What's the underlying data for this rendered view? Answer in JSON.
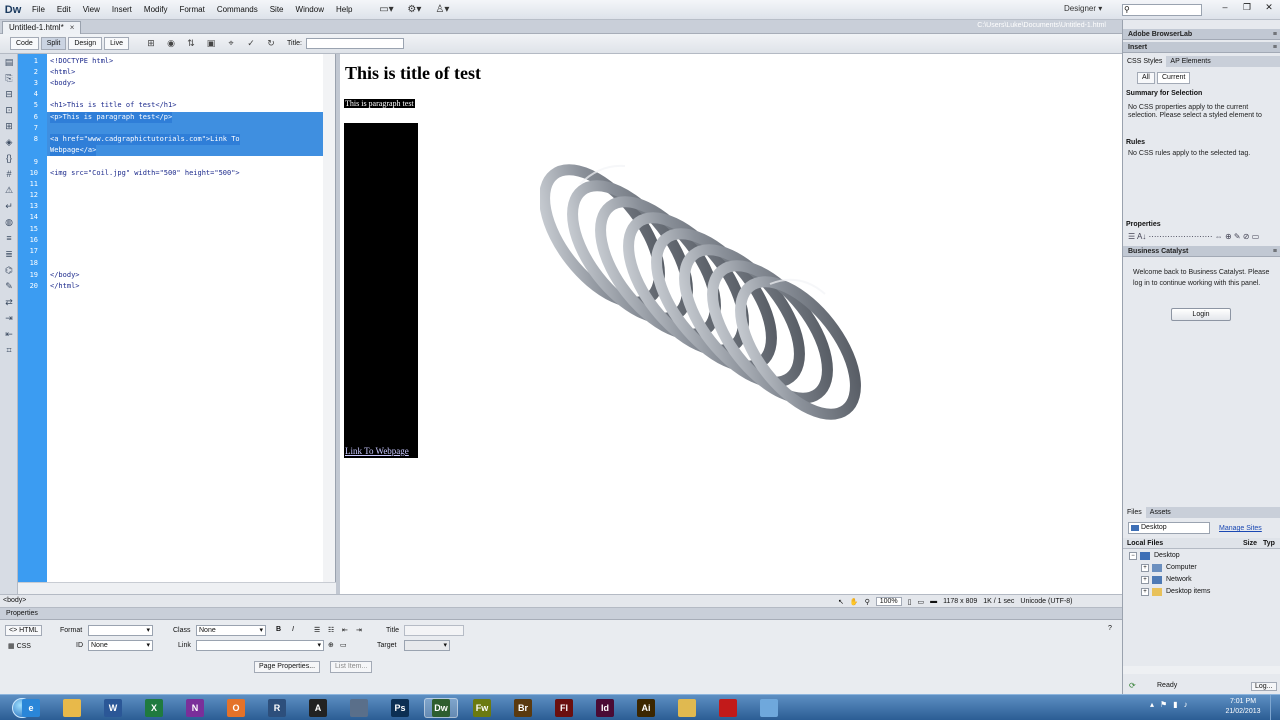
{
  "app": {
    "logo": "Dw",
    "menu": [
      "File",
      "Edit",
      "View",
      "Insert",
      "Modify",
      "Format",
      "Commands",
      "Site",
      "Window",
      "Help"
    ],
    "menu_icons": [
      "layout-icon",
      "gear-icon",
      "extend-icon"
    ],
    "workspace": "Designer",
    "search_placeholder": ""
  },
  "document": {
    "tab": "Untitled-1.html*",
    "path": "C:\\Users\\Luke\\Documents\\Untitled-1.html",
    "views": [
      "Code",
      "Split",
      "Design",
      "Live"
    ],
    "active_view": "Split",
    "title_label": "Title:",
    "title_value": ""
  },
  "code": {
    "lines": [
      {
        "n": "1",
        "text": "<!DOCTYPE html>"
      },
      {
        "n": "2",
        "text": "<html>"
      },
      {
        "n": "3",
        "text": "<body>"
      },
      {
        "n": "4",
        "text": ""
      },
      {
        "n": "5",
        "text": "<h1>This is title of test</h1>"
      },
      {
        "n": "6",
        "text": "<p>This is paragraph test</p>"
      },
      {
        "n": "7",
        "text": ""
      },
      {
        "n": "8",
        "text": "<a href=\"www.cadgraphictutorials.com\">Link To"
      },
      {
        "n": "9",
        "text": "Webpage</a>"
      },
      {
        "n": "10",
        "text": "<img src=\"Coil.jpg\" width=\"500\" height=\"500\">"
      },
      {
        "n": "11",
        "text": ""
      },
      {
        "n": "12",
        "text": ""
      },
      {
        "n": "13",
        "text": ""
      },
      {
        "n": "14",
        "text": ""
      },
      {
        "n": "15",
        "text": ""
      },
      {
        "n": "16",
        "text": ""
      },
      {
        "n": "17",
        "text": ""
      },
      {
        "n": "18",
        "text": ""
      },
      {
        "n": "19",
        "text": "</body>"
      },
      {
        "n": "20",
        "text": "</html>"
      }
    ]
  },
  "design": {
    "h1": "This is title of test",
    "paragraph": "This is paragraph test",
    "link": "Link To Webpage"
  },
  "status": {
    "tag": "<body>",
    "zoom": "100%",
    "size": "1178 x 809",
    "download": "1K / 1 sec",
    "encoding": "Unicode (UTF-8)"
  },
  "properties": {
    "title": "Properties",
    "html_btn": "HTML",
    "css_btn": "CSS",
    "format_label": "Format",
    "format_value": "",
    "class_label": "Class",
    "class_value": "None",
    "id_label": "ID",
    "id_value": "None",
    "link_label": "Link",
    "link_value": "",
    "title_label": "Title",
    "target_label": "Target",
    "bold": "B",
    "italic": "I",
    "page_props": "Page Properties...",
    "list_item": "List Item..."
  },
  "panels": {
    "browserlab": "Adobe BrowserLab",
    "insert": "Insert",
    "css_tab": "CSS Styles",
    "ap_tab": "AP Elements",
    "all_btn": "All",
    "current_btn": "Current",
    "summary_title": "Summary for Selection",
    "summary_text": "No CSS properties apply to the current selection.  Please select a styled element to",
    "rules_title": "Rules",
    "rules_text": "No CSS rules apply to the selected tag.",
    "properties_title": "Properties",
    "business_catalyst": "Business Catalyst",
    "bc_text": "Welcome back to Business Catalyst. Please log in to continue working with this panel.",
    "login": "Login",
    "files_tab": "Files",
    "assets_tab": "Assets",
    "site_select": "Desktop",
    "manage_sites": "Manage Sites",
    "local_files": "Local Files",
    "size_col": "Size",
    "type_col": "Typ",
    "tree": [
      "Desktop",
      "Computer",
      "Network",
      "Desktop items"
    ],
    "ready": "Ready",
    "log": "Log..."
  },
  "taskbar": {
    "apps": [
      {
        "name": "ie",
        "label": "e",
        "color": "#2a86d8"
      },
      {
        "name": "explorer",
        "label": "",
        "color": "#e8b94a"
      },
      {
        "name": "word",
        "label": "W",
        "color": "#2b5797"
      },
      {
        "name": "excel",
        "label": "X",
        "color": "#1f7a3f"
      },
      {
        "name": "onenote",
        "label": "N",
        "color": "#7a2f9a"
      },
      {
        "name": "outlook",
        "label": "O",
        "color": "#e4722a"
      },
      {
        "name": "revit",
        "label": "R",
        "color": "#2d4f7c"
      },
      {
        "name": "autocad",
        "label": "A",
        "color": "#222222"
      },
      {
        "name": "app-9",
        "label": "",
        "color": "#5a6f8a"
      },
      {
        "name": "photoshop",
        "label": "Ps",
        "color": "#0c2f53"
      },
      {
        "name": "dreamweaver",
        "label": "Dw",
        "color": "#2e5e2e"
      },
      {
        "name": "fireworks",
        "label": "Fw",
        "color": "#6b7a11"
      },
      {
        "name": "bridge",
        "label": "Br",
        "color": "#5a3a10"
      },
      {
        "name": "flash",
        "label": "Fl",
        "color": "#6a0f0f"
      },
      {
        "name": "indesign",
        "label": "Id",
        "color": "#4a0b35"
      },
      {
        "name": "illustrator",
        "label": "Ai",
        "color": "#3b2600"
      },
      {
        "name": "app-17",
        "label": "",
        "color": "#e0b950"
      },
      {
        "name": "recorder",
        "label": "",
        "color": "#c21a1a"
      },
      {
        "name": "app-19",
        "label": "",
        "color": "#6fa8dc"
      }
    ],
    "time": "7:01 PM",
    "date": "21/02/2013"
  }
}
